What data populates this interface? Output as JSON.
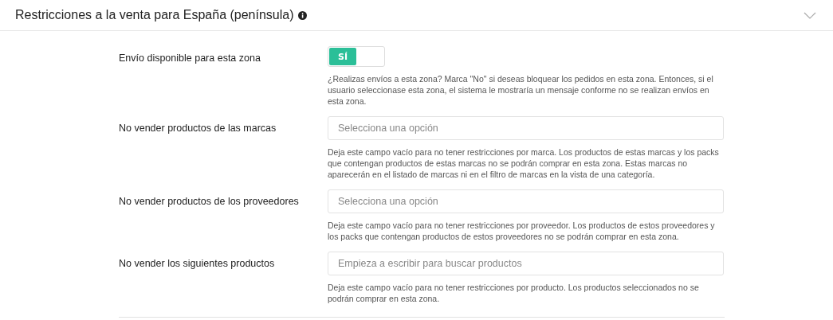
{
  "panel": {
    "title": "Restricciones a la venta para España (península)",
    "expanded": true
  },
  "fields": [
    {
      "kind": "toggle",
      "label": "Envío disponible para esta zona",
      "value": "SÍ",
      "on": true,
      "help": "¿Realizas envíos a esta zona? Marca \"No\" si deseas bloquear los pedidos en esta zona. Entonces, si el usuario seleccionase esta zona, el sistema le mostraría un mensaje conforme no se realizan envíos en esta zona."
    },
    {
      "kind": "select",
      "label": "No vender productos de las marcas",
      "placeholder": "Selecciona una opción",
      "help": "Deja este campo vacío para no tener restricciones por marca. Los productos de estas marcas y los packs que contengan productos de estas marcas no se podrán comprar en esta zona. Estas marcas no aparecerán en el listado de marcas ni en el filtro de marcas en la vista de una categoría."
    },
    {
      "kind": "select",
      "label": "No vender productos de los proveedores",
      "placeholder": "Selecciona una opción",
      "help": "Deja este campo vacío para no tener restricciones por proveedor. Los productos de estos proveedores y los packs que contengan productos de estos proveedores no se podrán comprar en esta zona."
    },
    {
      "kind": "select",
      "label": "No vender los siguientes productos",
      "placeholder": "Empieza a escribir para buscar productos",
      "help": "Deja este campo vacío para no tener restricciones por producto. Los productos seleccionados no se podrán comprar en esta zona."
    }
  ]
}
